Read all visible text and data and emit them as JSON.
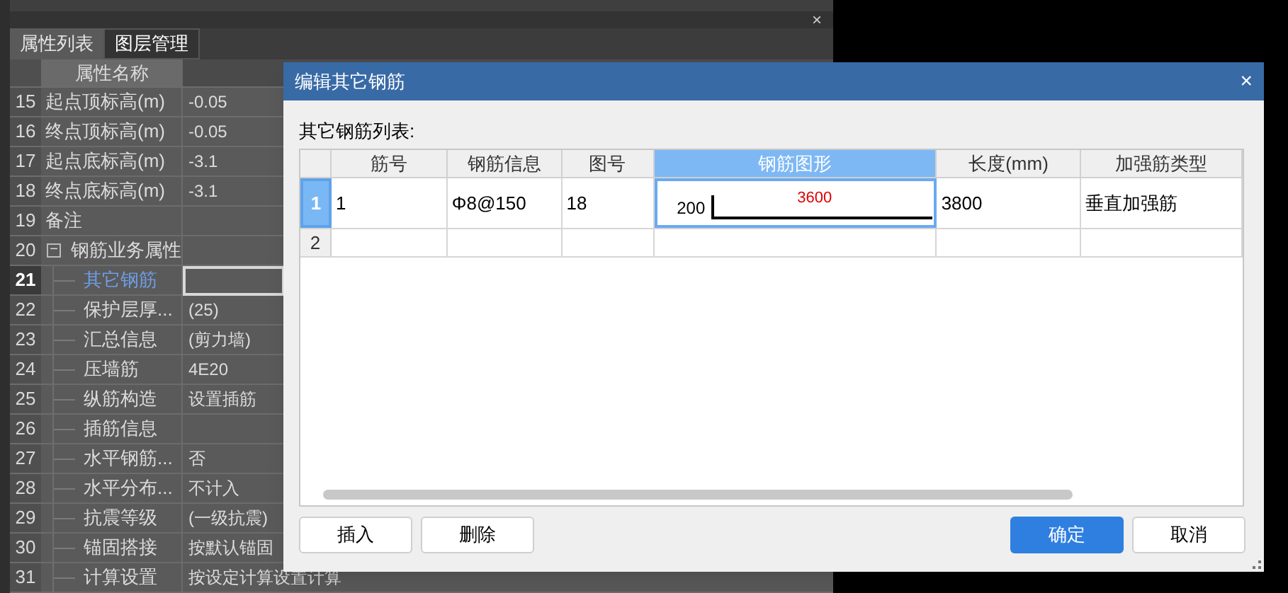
{
  "property_panel": {
    "close_glyph": "×",
    "tabs": [
      {
        "label": "属性列表",
        "selected": true
      },
      {
        "label": "图层管理",
        "selected": false
      }
    ],
    "header": "属性名称",
    "rows": [
      {
        "number": "15",
        "name": "起点顶标高(m)",
        "value": "-0.05",
        "selected": false
      },
      {
        "number": "16",
        "name": "终点顶标高(m)",
        "value": "-0.05",
        "selected": false
      },
      {
        "number": "17",
        "name": "起点底标高(m)",
        "value": "-3.1",
        "selected": false
      },
      {
        "number": "18",
        "name": "终点底标高(m)",
        "value": "-3.1",
        "selected": false
      },
      {
        "number": "19",
        "name": "备注",
        "selected": false
      },
      {
        "number": "20",
        "name": "钢筋业务属性",
        "selected": false,
        "expanded": true,
        "toggle_glyph": "−",
        "children": [
          {
            "number": "21",
            "name": "其它钢筋",
            "selected": true
          },
          {
            "number": "22",
            "name": "保护层厚...",
            "value": "(25)",
            "selected": false
          },
          {
            "number": "23",
            "name": "汇总信息",
            "value": "(剪力墙)",
            "selected": false
          },
          {
            "number": "24",
            "name": "压墙筋",
            "value": "4E20",
            "selected": false
          },
          {
            "number": "25",
            "name": "纵筋构造",
            "value": "设置插筋",
            "selected": false
          },
          {
            "number": "26",
            "name": "插筋信息",
            "selected": false
          },
          {
            "number": "27",
            "name": "水平钢筋...",
            "value": "否",
            "selected": false
          },
          {
            "number": "28",
            "name": "水平分布...",
            "value": "不计入",
            "selected": false
          },
          {
            "number": "29",
            "name": "抗震等级",
            "value": "(一级抗震)",
            "selected": false
          },
          {
            "number": "30",
            "name": "锚固搭接",
            "value": "按默认锚固",
            "selected": false
          },
          {
            "number": "31",
            "name": "计算设置",
            "value": "按设定计算设置计算",
            "selected": false
          }
        ]
      }
    ]
  },
  "dialog": {
    "title": "编辑其它钢筋",
    "close_glyph": "×",
    "list_label": "其它钢筋列表:",
    "table": {
      "columns": [
        {
          "label": "筋号",
          "selected": false
        },
        {
          "label": "钢筋信息",
          "selected": false
        },
        {
          "label": "图号",
          "selected": false
        },
        {
          "label": "钢筋图形",
          "selected": true
        },
        {
          "label": "长度(mm)",
          "selected": false
        },
        {
          "label": "加强筋类型",
          "selected": false
        }
      ],
      "rows": [
        {
          "number": "1",
          "selected": true,
          "cells": [
            {
              "kind": "text",
              "text": "1"
            },
            {
              "kind": "text",
              "text": "Φ8@150"
            },
            {
              "kind": "text",
              "text": "18"
            },
            {
              "kind": "shape",
              "hook": "200",
              "length": "3600"
            },
            {
              "kind": "text",
              "text": "3800"
            },
            {
              "kind": "text",
              "text": "垂直加强筋"
            }
          ]
        },
        {
          "number": "2",
          "selected": false,
          "cells": [
            {
              "kind": "text"
            },
            {
              "kind": "text"
            },
            {
              "kind": "text"
            },
            {
              "kind": "text"
            },
            {
              "kind": "text"
            },
            {
              "kind": "text"
            }
          ]
        }
      ]
    },
    "left_buttons": [
      {
        "label": "插入",
        "kind": "default"
      },
      {
        "label": "删除",
        "kind": "default"
      }
    ],
    "right_buttons": [
      {
        "label": "确定",
        "kind": "primary"
      },
      {
        "label": "取消",
        "kind": "default"
      }
    ]
  }
}
